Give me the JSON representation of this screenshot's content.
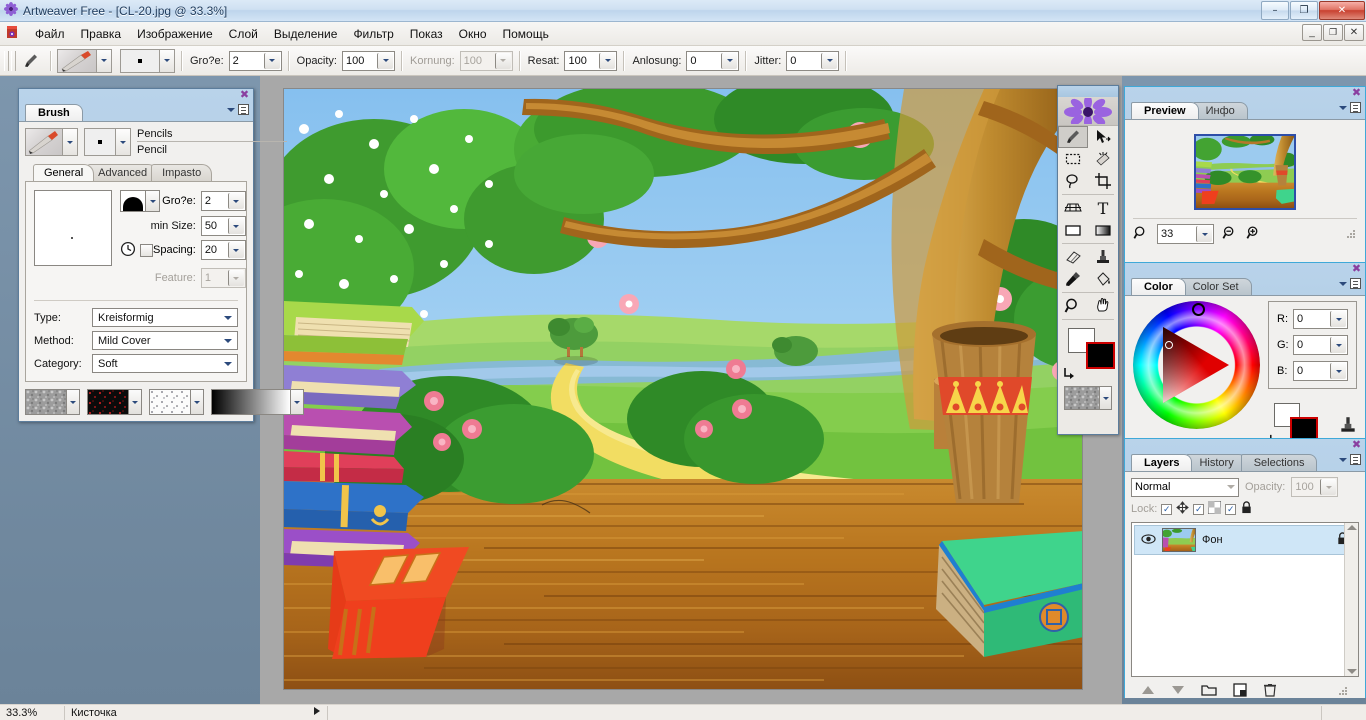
{
  "window": {
    "title": "Artweaver Free - [CL-20.jpg @ 33.3%]",
    "app_icon": "flower-icon",
    "buttons": {
      "minimize": "–",
      "maximize": "❐",
      "close": "✕"
    },
    "mdi_buttons": {
      "minimize": "_",
      "restore": "❐",
      "close": "✕"
    }
  },
  "menubar": {
    "items": [
      "Файл",
      "Правка",
      "Изображение",
      "Слой",
      "Выделение",
      "Фильтр",
      "Показ",
      "Окно",
      "Помощь"
    ]
  },
  "options_toolbar": {
    "brush_tool_icon": "paintbrush-icon",
    "brush_preset_icon": "pencil-preset-icon",
    "brush_tip_icon": "round-tip-icon",
    "fields": [
      {
        "label": "Gro?e:",
        "value": "2",
        "disabled": false
      },
      {
        "label": "Opacity:",
        "value": "100",
        "disabled": false
      },
      {
        "label": "Kornung:",
        "value": "100",
        "disabled": true
      },
      {
        "label": "Resat:",
        "value": "100",
        "disabled": false
      },
      {
        "label": "Anlosung:",
        "value": "0",
        "disabled": false
      },
      {
        "label": "Jitter:",
        "value": "0",
        "disabled": false
      }
    ]
  },
  "brush_panel": {
    "tab_active": "Brush",
    "preset_category": "Pencils",
    "preset_name": "Pencil",
    "subtabs": [
      "General",
      "Advanced",
      "Impasto"
    ],
    "subtab_active": "General",
    "shape_icon": "brush-shape-icon",
    "timer_icon": "clock-icon",
    "fields": [
      {
        "label": "Gro?e:",
        "value": "2",
        "disabled": false
      },
      {
        "label": "min Size:",
        "value": "50",
        "disabled": false
      },
      {
        "label": "Spacing:",
        "value": "20",
        "disabled": false
      },
      {
        "label": "Feature:",
        "value": "1",
        "disabled": true
      }
    ],
    "selects": [
      {
        "label": "Type:",
        "value": "Kreisformig"
      },
      {
        "label": "Method:",
        "value": "Mild Cover"
      },
      {
        "label": "Category:",
        "value": "Soft"
      }
    ],
    "texture_swatches": [
      "paper-texture",
      "pattern-texture",
      "speckle-texture",
      "gradient-swatch"
    ]
  },
  "tool_palette": {
    "logo_icon": "flower-logo-icon",
    "tools": [
      {
        "name": "brush-tool",
        "glyph": "brush",
        "selected": true
      },
      {
        "name": "move-tool",
        "glyph": "arrow-move",
        "selected": false
      },
      {
        "name": "rectangular-marquee-tool",
        "glyph": "marquee",
        "selected": false
      },
      {
        "name": "magic-wand-tool",
        "glyph": "wand",
        "selected": false
      },
      {
        "name": "lasso-tool",
        "glyph": "lasso",
        "selected": false
      },
      {
        "name": "crop-tool",
        "glyph": "crop",
        "selected": false
      },
      {
        "name": "perspective-grid-tool",
        "glyph": "grid",
        "selected": false
      },
      {
        "name": "text-tool",
        "glyph": "T",
        "selected": false
      },
      {
        "name": "shape-tool",
        "glyph": "rect",
        "selected": false
      },
      {
        "name": "gradient-tool",
        "glyph": "gradient",
        "selected": false
      },
      {
        "name": "eraser-tool",
        "glyph": "eraser",
        "selected": false
      },
      {
        "name": "clone-stamp-tool",
        "glyph": "stamp",
        "selected": false
      },
      {
        "name": "eyedropper-tool",
        "glyph": "eyedropper",
        "selected": false
      },
      {
        "name": "paint-bucket-tool",
        "glyph": "bucket",
        "selected": false
      },
      {
        "name": "zoom-tool",
        "glyph": "magnifier",
        "selected": false
      },
      {
        "name": "hand-tool",
        "glyph": "hand",
        "selected": false
      }
    ],
    "foreground_color": "#000000",
    "background_color": "#ffffff",
    "texture_swatch": "paper-texture"
  },
  "preview_panel": {
    "tabs": [
      "Preview",
      "Инфо"
    ],
    "tab_active": "Preview",
    "zoom_value": "33",
    "icons": [
      "magnifier-icon",
      "zoom-out-icon",
      "zoom-in-icon"
    ]
  },
  "color_panel": {
    "tabs": [
      "Color",
      "Color Set"
    ],
    "tab_active": "Color",
    "channels": [
      {
        "label": "R:",
        "value": "0"
      },
      {
        "label": "G:",
        "value": "0"
      },
      {
        "label": "B:",
        "value": "0"
      }
    ],
    "foreground": "#000000",
    "background": "#ffffff",
    "swap_icon": "swap-colors-icon",
    "clone_icon": "clone-color-icon"
  },
  "layers_panel": {
    "tabs": [
      "Layers",
      "History",
      "Selections"
    ],
    "tab_active": "Layers",
    "blend_mode": "Normal",
    "opacity_label": "Opacity:",
    "opacity_value": "100",
    "lock_label": "Lock:",
    "lock_icons": [
      "move-lock-icon",
      "transparency-lock-icon",
      "all-lock-icon"
    ],
    "layers": [
      {
        "name": "Фон",
        "visible": true,
        "locked": true
      }
    ],
    "toolbar_icons": [
      "move-up-icon",
      "move-down-icon",
      "new-group-icon",
      "new-layer-icon",
      "delete-layer-icon"
    ]
  },
  "statusbar": {
    "zoom": "33.3%",
    "tool": "Кисточка"
  },
  "canvas": {
    "document_name": "CL-20.jpg",
    "zoom": "33.3%",
    "description": "cartoon wooden floor with books, tree, and green meadow background"
  }
}
